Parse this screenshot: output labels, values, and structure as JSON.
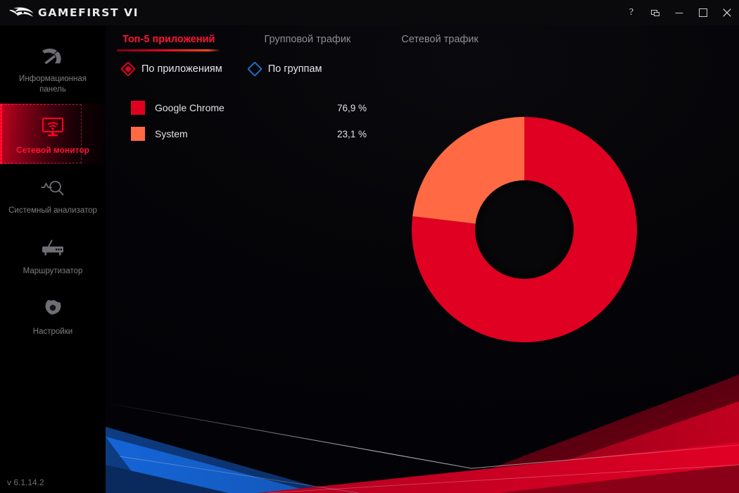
{
  "window": {
    "title": "GAMEFIRST VI",
    "logo_icon": "rog-eye-logo",
    "controls": [
      {
        "name": "help-button",
        "icon": "question-mark-icon",
        "label": "?"
      },
      {
        "name": "restore-button",
        "icon": "cascade-windows-icon",
        "label": ""
      },
      {
        "name": "minimize-button",
        "icon": "minimize-icon",
        "label": ""
      },
      {
        "name": "maximize-button",
        "icon": "maximize-icon",
        "label": ""
      },
      {
        "name": "close-button",
        "icon": "close-icon",
        "label": ""
      }
    ]
  },
  "sidebar": {
    "version": "v 6.1.14.2",
    "items": [
      {
        "label": "Информационная панель",
        "icon": "gauge-icon",
        "active": false
      },
      {
        "label": "Сетевой монитор",
        "icon": "network-monitor-icon",
        "active": true
      },
      {
        "label": "Системный анализатор",
        "icon": "analyzer-icon",
        "active": false
      },
      {
        "label": "Маршрутизатор",
        "icon": "router-icon",
        "active": false
      },
      {
        "label": "Настройки",
        "icon": "gear-icon",
        "active": false
      }
    ]
  },
  "tabs": [
    {
      "label": "Топ-5 приложений",
      "active": true
    },
    {
      "label": "Групповой трафик",
      "active": false
    },
    {
      "label": "Сетевой трафик",
      "active": false
    }
  ],
  "view_mode": {
    "options": [
      {
        "label": "По приложениям",
        "selected": true,
        "color": "#e50020"
      },
      {
        "label": "По группам",
        "selected": false,
        "color": "#1f6fd0"
      }
    ]
  },
  "colors": {
    "accent_red": "#ff1436",
    "chrome_red": "#e00021",
    "system_orange": "#ff6a45",
    "sidebar_bg": "#000000",
    "content_bg": "#05050a",
    "titlebar_bg": "#0a0a0c"
  },
  "chart_data": {
    "type": "pie",
    "title": "Топ-5 приложений",
    "subtype": "donut",
    "categories": [
      "Google Chrome",
      "System"
    ],
    "values": [
      76.9,
      23.1
    ],
    "value_labels": [
      "76,9 %",
      "23,1 %"
    ],
    "unit": "%",
    "colors": [
      "#e00021",
      "#ff6a45"
    ],
    "start_angle_deg": 0,
    "direction": "clockwise",
    "inner_radius_ratio": 0.42,
    "legend_position": "left",
    "grid": false
  }
}
